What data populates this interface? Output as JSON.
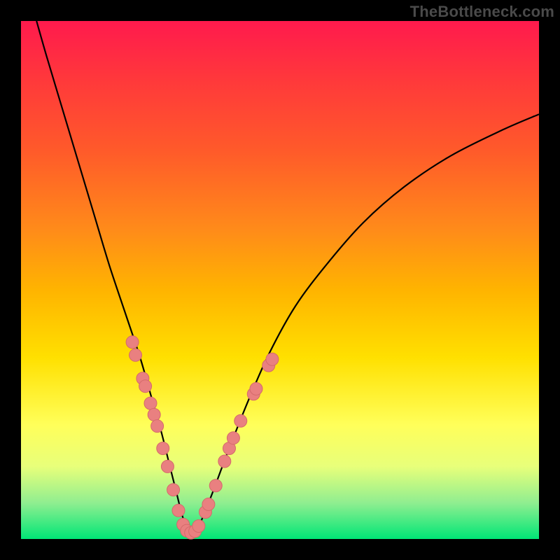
{
  "watermark": "TheBottleneck.com",
  "colors": {
    "curve_stroke": "#000000",
    "marker_fill": "#e98080",
    "marker_stroke": "#d46a6a"
  },
  "chart_data": {
    "type": "line",
    "title": "",
    "xlabel": "",
    "ylabel": "",
    "xlim": [
      0,
      100
    ],
    "ylim": [
      0,
      100
    ],
    "series": [
      {
        "name": "bottleneck-curve",
        "x": [
          3,
          5,
          8,
          11,
          14,
          17,
          20,
          23,
          25,
          27,
          28.5,
          30,
          31,
          32,
          33,
          34,
          35,
          37,
          40,
          44,
          48,
          53,
          59,
          66,
          74,
          83,
          93,
          100
        ],
        "y": [
          100,
          93,
          83,
          73,
          63,
          53,
          44,
          35,
          28,
          21,
          15,
          9,
          5,
          2,
          1,
          1.5,
          4,
          9,
          17,
          27,
          36,
          45,
          53,
          61,
          68,
          74,
          79,
          82
        ]
      }
    ],
    "markers": [
      {
        "x": 21.5,
        "y": 38
      },
      {
        "x": 22.1,
        "y": 35.5
      },
      {
        "x": 23.5,
        "y": 31
      },
      {
        "x": 24.0,
        "y": 29.5
      },
      {
        "x": 25.0,
        "y": 26.2
      },
      {
        "x": 25.7,
        "y": 24.0
      },
      {
        "x": 26.3,
        "y": 21.8
      },
      {
        "x": 27.4,
        "y": 17.5
      },
      {
        "x": 28.3,
        "y": 14.0
      },
      {
        "x": 29.4,
        "y": 9.5
      },
      {
        "x": 30.4,
        "y": 5.5
      },
      {
        "x": 31.3,
        "y": 2.8
      },
      {
        "x": 32.0,
        "y": 1.6
      },
      {
        "x": 32.8,
        "y": 1.2
      },
      {
        "x": 33.6,
        "y": 1.5
      },
      {
        "x": 34.3,
        "y": 2.5
      },
      {
        "x": 35.6,
        "y": 5.2
      },
      {
        "x": 36.2,
        "y": 6.7
      },
      {
        "x": 37.6,
        "y": 10.3
      },
      {
        "x": 39.3,
        "y": 15.0
      },
      {
        "x": 40.2,
        "y": 17.5
      },
      {
        "x": 41.0,
        "y": 19.5
      },
      {
        "x": 42.4,
        "y": 22.8
      },
      {
        "x": 44.9,
        "y": 28.0
      },
      {
        "x": 45.4,
        "y": 29.0
      },
      {
        "x": 47.8,
        "y": 33.5
      },
      {
        "x": 48.5,
        "y": 34.7
      }
    ]
  }
}
